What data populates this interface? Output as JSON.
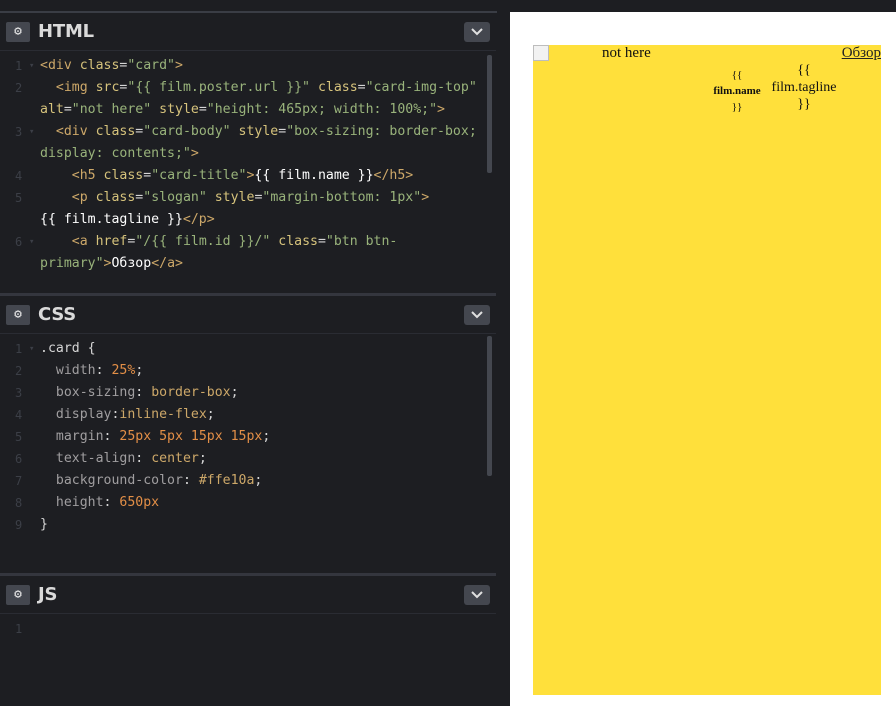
{
  "panels": {
    "html": {
      "title": "HTML",
      "lines": [
        {
          "n": "1",
          "fold": true
        },
        {
          "n": "2"
        },
        {
          "n": "3",
          "fold": true
        },
        {
          "n": "4"
        },
        {
          "n": "5"
        },
        {
          "n": "6",
          "fold": true
        }
      ],
      "code": {
        "l1_tag": "<div ",
        "l1_attr": "class",
        "l1_eq": "=",
        "l1_str": "\"card\"",
        "l1_close": ">",
        "l2_tag": "<img ",
        "l2_a1": "src",
        "l2_s1": "\"{{ film.poster.url }}\"",
        "l2_a2": "class",
        "l2_s2": "\"card-img-top\"",
        "l2_a3": "alt",
        "l2_s3": "\"not here\"",
        "l2_a4": "style",
        "l2_s4": "\"height: 465px; width: 100%;\"",
        "l2_close": ">",
        "l3_tag": "<div ",
        "l3_a1": "class",
        "l3_s1": "\"card-body\"",
        "l3_a2": "style",
        "l3_s2": "\"box-sizing: border-box; display: contents;\"",
        "l3_close": ">",
        "l4_tag": "<h5 ",
        "l4_a1": "class",
        "l4_s1": "\"card-title\"",
        "l4_gt": ">",
        "l4_txt": "{{ film.name }}",
        "l4_end": "</h5>",
        "l5_tag": "<p ",
        "l5_a1": "class",
        "l5_s1": "\"slogan\"",
        "l5_a2": "style",
        "l5_s2": "\"margin-bottom: 1px\"",
        "l5_gt": ">",
        "l5_txt": "{{ film.tagline }}",
        "l5_end": "</p>",
        "l6_tag": "<a ",
        "l6_a1": "href",
        "l6_s1": "\"/{{ film.id }}/\"",
        "l6_a2": "class",
        "l6_s2": "\"btn btn-primary\"",
        "l6_gt": ">",
        "l6_txt": "Обзор",
        "l6_end": "</a>"
      }
    },
    "css": {
      "title": "CSS",
      "line_numbers": [
        "1",
        "2",
        "3",
        "4",
        "5",
        "6",
        "7",
        "8",
        "9"
      ],
      "selector": ".card {",
      "decls": [
        {
          "prop": "width",
          "value": "25%",
          "kind": "num"
        },
        {
          "prop": "box-sizing",
          "value": "border-box",
          "kind": "val"
        },
        {
          "prop": "display",
          "value": "inline-flex",
          "kind": "val",
          "nospace": true
        },
        {
          "prop": "margin",
          "value": "25px 5px 15px 15px",
          "kind": "num"
        },
        {
          "prop": "text-align",
          "value": "center",
          "kind": "val"
        },
        {
          "prop": "background-color",
          "value": "#ffe10a",
          "kind": "val"
        },
        {
          "prop": "height",
          "value": "650px",
          "kind": "num",
          "nosemi": true
        }
      ],
      "close": "}"
    },
    "js": {
      "title": "JS",
      "line_numbers": [
        "1"
      ]
    }
  },
  "preview": {
    "card_color": "#ffe03b",
    "img_alt": "not here",
    "film_name_open": "{{",
    "film_name_text": "film.name",
    "film_name_close": "}}",
    "tagline_open": "{{",
    "tagline_text": "film.tagline",
    "tagline_close": "}}",
    "link_text": "Обзор"
  },
  "icons": {
    "settings": "gear-icon",
    "collapse": "chevron-down-icon"
  }
}
